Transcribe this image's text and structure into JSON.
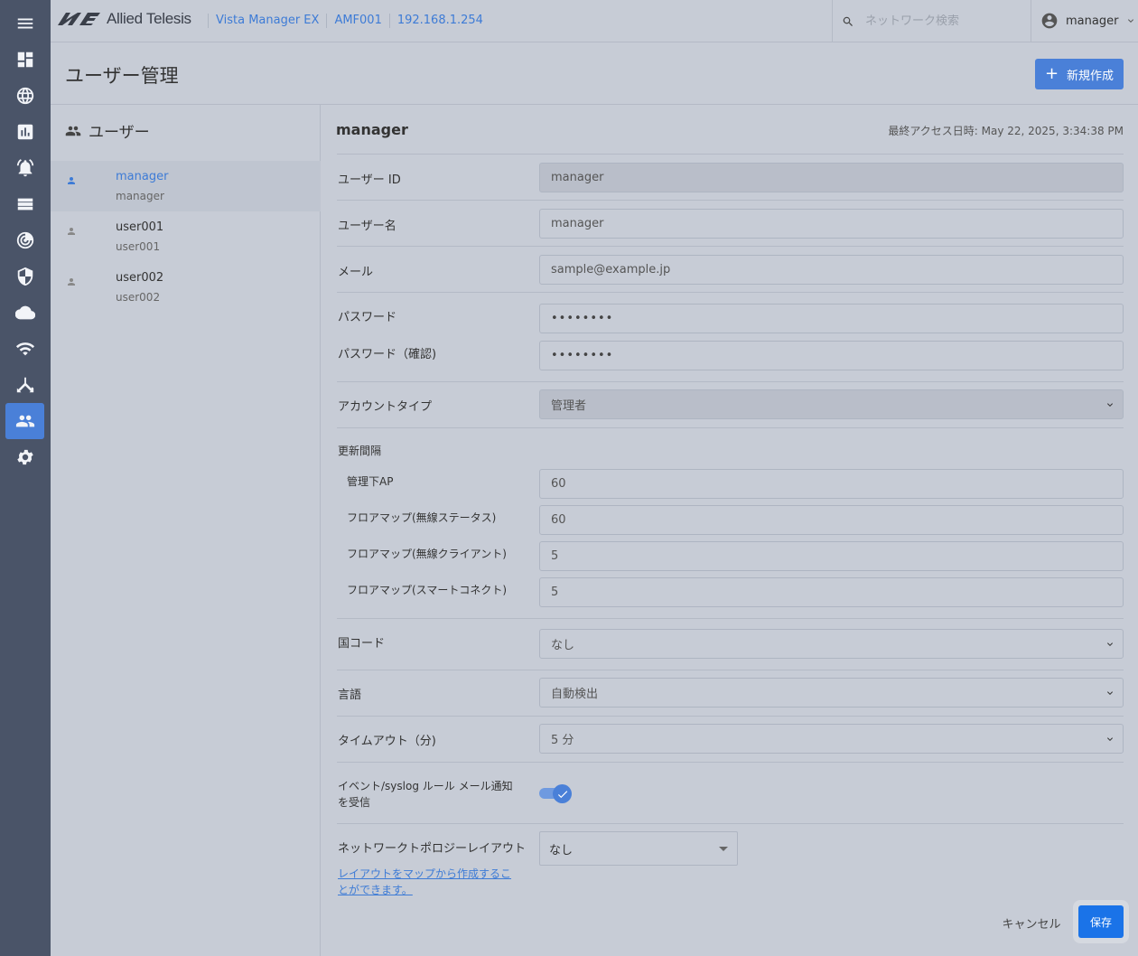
{
  "app": {
    "brand": "Allied Telesis",
    "breadcrumbs": [
      "Vista Manager EX",
      "AMF001",
      "192.168.1.254"
    ],
    "search_placeholder": "ネットワーク検索",
    "current_user": "manager"
  },
  "sidebar": {
    "items": [
      {
        "icon": "menu-icon",
        "active": false
      },
      {
        "icon": "dashboard-icon",
        "active": false
      },
      {
        "icon": "globe-icon",
        "active": false
      },
      {
        "icon": "chart-icon",
        "active": false
      },
      {
        "icon": "alarm-icon",
        "active": false
      },
      {
        "icon": "list-icon",
        "active": false
      },
      {
        "icon": "radar-icon",
        "active": false
      },
      {
        "icon": "shield-icon",
        "active": false
      },
      {
        "icon": "cloud-icon",
        "active": false
      },
      {
        "icon": "wifi-icon",
        "active": false
      },
      {
        "icon": "topology-icon",
        "active": false
      },
      {
        "icon": "users-icon",
        "active": true
      },
      {
        "icon": "settings-icon",
        "active": false
      }
    ]
  },
  "page": {
    "title": "ユーザー管理",
    "new_button": "新規作成"
  },
  "user_list": {
    "header": "ユーザー",
    "users": [
      {
        "name": "manager",
        "sub": "manager",
        "selected": true
      },
      {
        "name": "user001",
        "sub": "user001",
        "selected": false
      },
      {
        "name": "user002",
        "sub": "user002",
        "selected": false
      }
    ]
  },
  "detail": {
    "title": "manager",
    "last_access": "最終アクセス日時: May 22, 2025, 3:34:38 PM",
    "user_id_label": "ユーザー ID",
    "user_id_value": "manager",
    "username_label": "ユーザー名",
    "username_value": "manager",
    "email_label": "メール",
    "email_value": "sample@example.jp",
    "password_label": "パスワード",
    "password_value": "••••••••",
    "password_confirm_label": "パスワード（確認)",
    "password_confirm_value": "••••••••",
    "account_type_label": "アカウントタイプ",
    "account_type_value": "管理者",
    "refresh_label": "更新間隔",
    "refresh_ap_label": "管理下AP",
    "refresh_ap_value": "60",
    "refresh_floor_status_label": "フロアマップ(無線ステータス)",
    "refresh_floor_status_value": "60",
    "refresh_floor_client_label": "フロアマップ(無線クライアント)",
    "refresh_floor_client_value": "5",
    "refresh_floor_smart_label": "フロアマップ(スマートコネクト)",
    "refresh_floor_smart_value": "5",
    "country_label": "国コード",
    "country_value": "なし",
    "language_label": "言語",
    "language_value": "自動検出",
    "timeout_label": "タイムアウト（分)",
    "timeout_value": "5 分",
    "event_mail_label_line1": "イベント/syslog ルール メール通知",
    "event_mail_label_line2": "を受信",
    "event_mail_enabled": true,
    "topology_label": "ネットワークトポロジーレイアウト",
    "topology_value": "なし",
    "topology_link": "レイアウトをマップから作成することができます。",
    "cancel": "キャンセル",
    "save": "保存"
  },
  "colors": {
    "accent": "#4a80d8",
    "link": "#3d7bd6",
    "sidebar": "#4a5468",
    "background": "#c7ccd6",
    "save_button": "#1a73e8"
  }
}
